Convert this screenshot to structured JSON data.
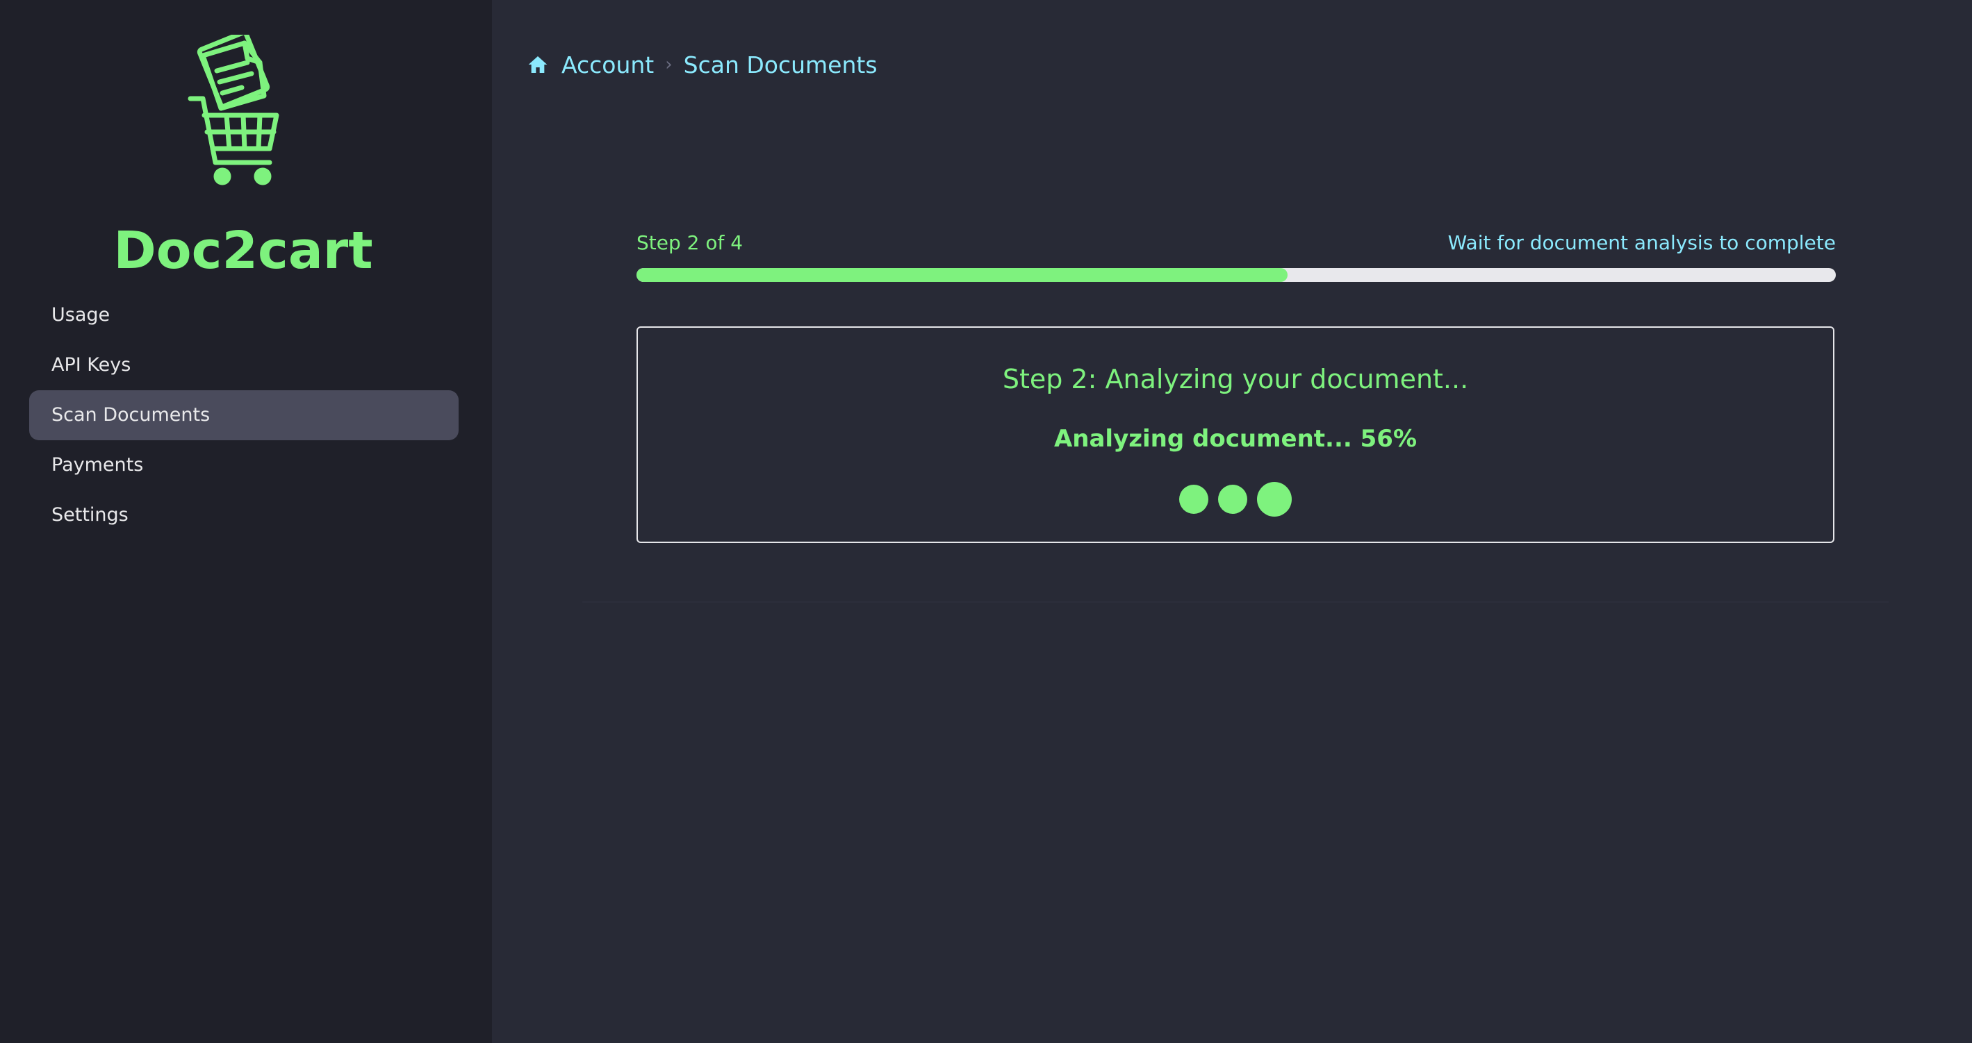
{
  "app": {
    "name": "Doc2cart",
    "logo_icon": "cart-document-icon",
    "accent_color": "#7ef27e"
  },
  "sidebar": {
    "items": [
      {
        "label": "Usage",
        "active": false
      },
      {
        "label": "API Keys",
        "active": false
      },
      {
        "label": "Scan Documents",
        "active": true
      },
      {
        "label": "Payments",
        "active": false
      },
      {
        "label": "Settings",
        "active": false
      }
    ]
  },
  "breadcrumb": {
    "home_icon": "home-icon",
    "items": [
      "Account",
      "Scan Documents"
    ]
  },
  "stepper": {
    "step_label": "Step 2 of 4",
    "hint": "Wait for document analysis to complete",
    "progress_percent": 54.3
  },
  "analysis": {
    "title": "Step 2: Analyzing your document...",
    "status": "Analyzing document... 56%"
  }
}
